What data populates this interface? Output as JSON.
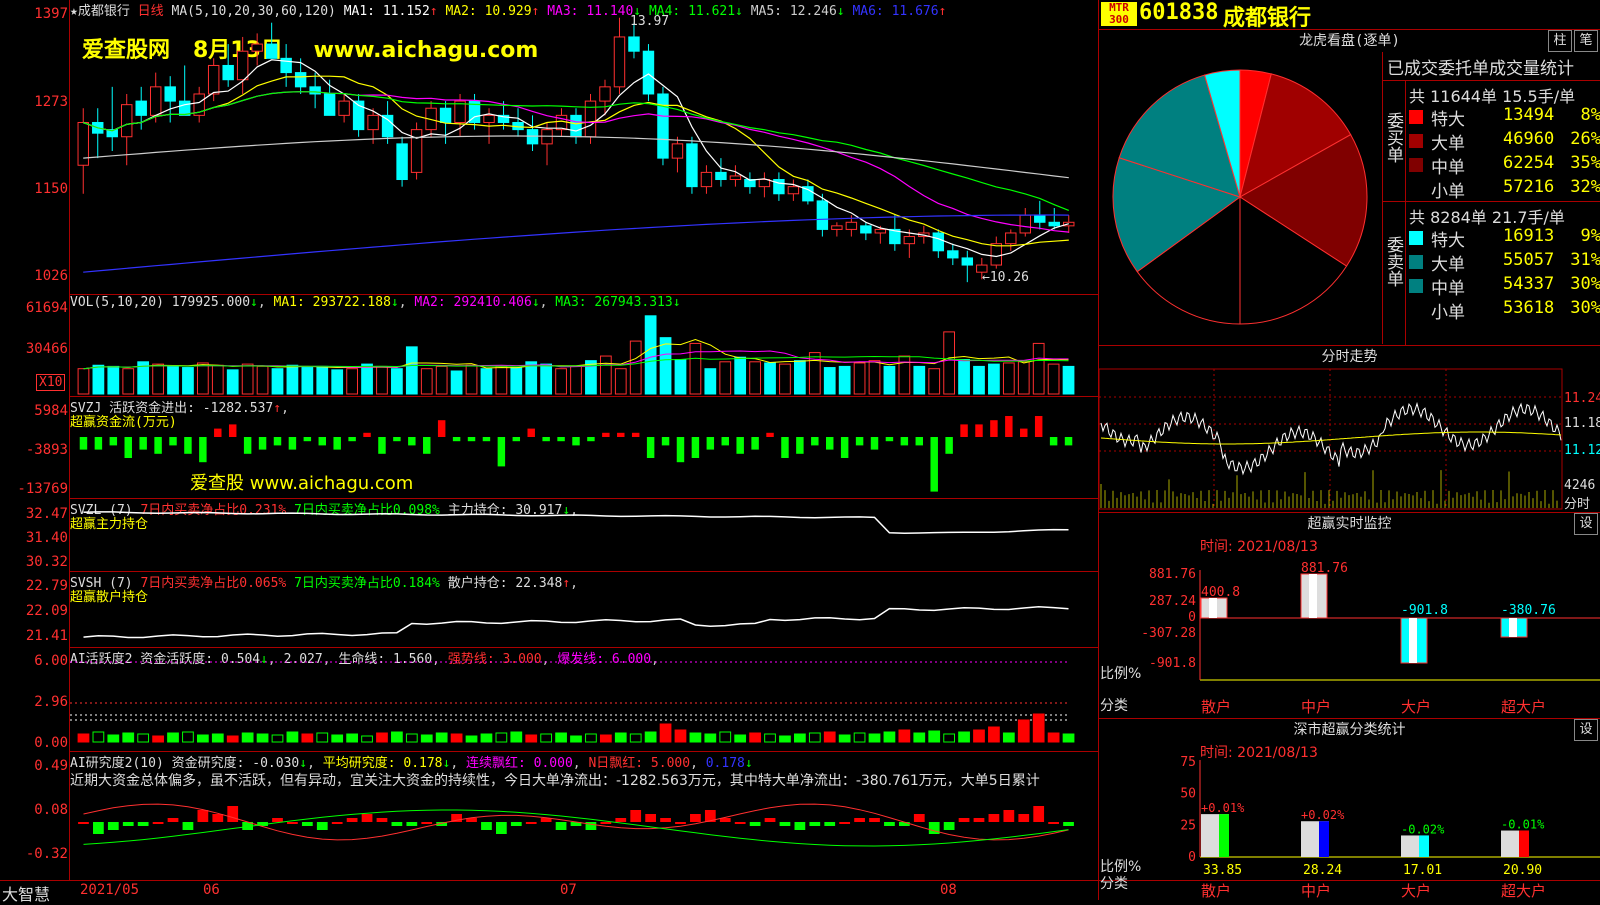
{
  "kline": {
    "header": {
      "name": "★成都银行",
      "period": "日线",
      "ma_def": "MA(5,10,20,30,60,120)",
      "ma1": "MA1: 11.152",
      "ma2": "MA2: 10.929",
      "ma3": "MA3: 11.140",
      "ma4": "MA4: 11.621",
      "ma5": "MA5: 12.246",
      "ma6": "MA6: 11.676"
    },
    "watermark": {
      "site": "爱查股网",
      "date": "8月13日",
      "url": "www.aichagu.com"
    },
    "axis": [
      "1397",
      "1273",
      "1150",
      "1026"
    ],
    "high_label": "13.97",
    "low_label": "←10.26",
    "candles": [
      {
        "o": 11.9,
        "h": 12.7,
        "l": 11.5,
        "c": 12.5
      },
      {
        "o": 12.5,
        "h": 12.7,
        "l": 12.0,
        "c": 12.35
      },
      {
        "o": 12.4,
        "h": 13.0,
        "l": 12.1,
        "c": 12.3
      },
      {
        "o": 12.3,
        "h": 12.9,
        "l": 11.9,
        "c": 12.75
      },
      {
        "o": 12.8,
        "h": 13.0,
        "l": 12.4,
        "c": 12.6
      },
      {
        "o": 12.6,
        "h": 13.2,
        "l": 12.5,
        "c": 13.0
      },
      {
        "o": 13.0,
        "h": 13.15,
        "l": 12.5,
        "c": 12.8
      },
      {
        "o": 12.8,
        "h": 13.3,
        "l": 12.6,
        "c": 12.6
      },
      {
        "o": 12.6,
        "h": 13.0,
        "l": 12.5,
        "c": 12.9
      },
      {
        "o": 12.9,
        "h": 13.4,
        "l": 12.8,
        "c": 13.3
      },
      {
        "o": 13.3,
        "h": 13.6,
        "l": 13.0,
        "c": 13.1
      },
      {
        "o": 13.1,
        "h": 13.7,
        "l": 12.9,
        "c": 13.5
      },
      {
        "o": 13.5,
        "h": 13.75,
        "l": 13.3,
        "c": 13.6
      },
      {
        "o": 13.6,
        "h": 13.9,
        "l": 13.4,
        "c": 13.4
      },
      {
        "o": 13.4,
        "h": 13.6,
        "l": 13.0,
        "c": 13.2
      },
      {
        "o": 13.2,
        "h": 13.4,
        "l": 12.9,
        "c": 13.0
      },
      {
        "o": 13.0,
        "h": 13.2,
        "l": 12.7,
        "c": 12.9
      },
      {
        "o": 12.9,
        "h": 13.1,
        "l": 12.6,
        "c": 12.6
      },
      {
        "o": 12.6,
        "h": 12.9,
        "l": 12.5,
        "c": 12.8
      },
      {
        "o": 12.8,
        "h": 12.9,
        "l": 12.3,
        "c": 12.4
      },
      {
        "o": 12.4,
        "h": 12.7,
        "l": 12.2,
        "c": 12.6
      },
      {
        "o": 12.6,
        "h": 12.8,
        "l": 12.2,
        "c": 12.3
      },
      {
        "o": 12.2,
        "h": 12.3,
        "l": 11.6,
        "c": 11.7
      },
      {
        "o": 11.8,
        "h": 12.5,
        "l": 11.7,
        "c": 12.4
      },
      {
        "o": 12.4,
        "h": 12.8,
        "l": 12.3,
        "c": 12.7
      },
      {
        "o": 12.7,
        "h": 12.8,
        "l": 12.2,
        "c": 12.5
      },
      {
        "o": 12.5,
        "h": 12.9,
        "l": 12.3,
        "c": 12.8
      },
      {
        "o": 12.8,
        "h": 12.9,
        "l": 12.4,
        "c": 12.5
      },
      {
        "o": 12.5,
        "h": 12.7,
        "l": 12.2,
        "c": 12.6
      },
      {
        "o": 12.6,
        "h": 12.8,
        "l": 12.4,
        "c": 12.5
      },
      {
        "o": 12.5,
        "h": 12.7,
        "l": 12.3,
        "c": 12.4
      },
      {
        "o": 12.4,
        "h": 12.6,
        "l": 12.1,
        "c": 12.2
      },
      {
        "o": 12.2,
        "h": 12.5,
        "l": 11.9,
        "c": 12.4
      },
      {
        "o": 12.4,
        "h": 12.7,
        "l": 12.3,
        "c": 12.6
      },
      {
        "o": 12.6,
        "h": 12.7,
        "l": 12.2,
        "c": 12.3
      },
      {
        "o": 12.3,
        "h": 12.9,
        "l": 12.2,
        "c": 12.8
      },
      {
        "o": 12.8,
        "h": 13.1,
        "l": 12.6,
        "c": 13.0
      },
      {
        "o": 13.0,
        "h": 13.97,
        "l": 12.9,
        "c": 13.7
      },
      {
        "o": 13.7,
        "h": 13.9,
        "l": 13.4,
        "c": 13.5
      },
      {
        "o": 13.5,
        "h": 13.6,
        "l": 12.8,
        "c": 12.9
      },
      {
        "o": 12.9,
        "h": 13.0,
        "l": 11.9,
        "c": 12.0
      },
      {
        "o": 12.0,
        "h": 12.3,
        "l": 11.8,
        "c": 12.2
      },
      {
        "o": 12.2,
        "h": 12.3,
        "l": 11.5,
        "c": 11.6
      },
      {
        "o": 11.6,
        "h": 11.9,
        "l": 11.5,
        "c": 11.8
      },
      {
        "o": 11.8,
        "h": 12.0,
        "l": 11.6,
        "c": 11.7
      },
      {
        "o": 11.7,
        "h": 11.9,
        "l": 11.6,
        "c": 11.75
      },
      {
        "o": 11.7,
        "h": 11.8,
        "l": 11.5,
        "c": 11.6
      },
      {
        "o": 11.6,
        "h": 11.8,
        "l": 11.45,
        "c": 11.7
      },
      {
        "o": 11.7,
        "h": 11.8,
        "l": 11.4,
        "c": 11.5
      },
      {
        "o": 11.5,
        "h": 11.7,
        "l": 11.4,
        "c": 11.6
      },
      {
        "o": 11.6,
        "h": 11.7,
        "l": 11.35,
        "c": 11.4
      },
      {
        "o": 11.4,
        "h": 11.5,
        "l": 10.9,
        "c": 11.0
      },
      {
        "o": 11.0,
        "h": 11.1,
        "l": 10.9,
        "c": 11.05
      },
      {
        "o": 11.0,
        "h": 11.2,
        "l": 10.9,
        "c": 11.1
      },
      {
        "o": 11.05,
        "h": 11.1,
        "l": 10.85,
        "c": 10.95
      },
      {
        "o": 10.95,
        "h": 11.05,
        "l": 10.8,
        "c": 11.0
      },
      {
        "o": 11.0,
        "h": 11.2,
        "l": 10.7,
        "c": 10.8
      },
      {
        "o": 10.8,
        "h": 11.0,
        "l": 10.6,
        "c": 10.9
      },
      {
        "o": 10.9,
        "h": 11.05,
        "l": 10.8,
        "c": 10.95
      },
      {
        "o": 10.95,
        "h": 11.0,
        "l": 10.6,
        "c": 10.7
      },
      {
        "o": 10.7,
        "h": 10.8,
        "l": 10.5,
        "c": 10.6
      },
      {
        "o": 10.6,
        "h": 10.7,
        "l": 10.26,
        "c": 10.5
      },
      {
        "o": 10.4,
        "h": 10.6,
        "l": 10.3,
        "c": 10.5
      },
      {
        "o": 10.5,
        "h": 10.9,
        "l": 10.45,
        "c": 10.8
      },
      {
        "o": 10.8,
        "h": 11.0,
        "l": 10.7,
        "c": 10.95
      },
      {
        "o": 10.95,
        "h": 11.3,
        "l": 10.9,
        "c": 11.2
      },
      {
        "o": 11.2,
        "h": 11.4,
        "l": 11.0,
        "c": 11.1
      },
      {
        "o": 11.1,
        "h": 11.3,
        "l": 11.0,
        "c": 11.05
      },
      {
        "o": 11.05,
        "h": 11.2,
        "l": 10.95,
        "c": 11.1
      }
    ]
  },
  "vol": {
    "header": "VOL(5,10,20)",
    "vol": "179925.000",
    "ma1": "MA1: 293722.188",
    "ma2": "MA2: 292410.406",
    "ma3": "MA3: 267943.313",
    "axis": [
      "61694",
      "30466"
    ],
    "unit": "X10",
    "bars": [
      22,
      25,
      24,
      22,
      28,
      26,
      24,
      23,
      27,
      25,
      21,
      26,
      24,
      22,
      25,
      23,
      24,
      21,
      22,
      26,
      24,
      22,
      41,
      22,
      24,
      20,
      25,
      22,
      24,
      23,
      28,
      26,
      22,
      24,
      29,
      33,
      22,
      46,
      68,
      49,
      30,
      44,
      22,
      28,
      32,
      28,
      27,
      26,
      29,
      36,
      23,
      24,
      27,
      29,
      24,
      33,
      24,
      22,
      54,
      30,
      24,
      26,
      27,
      28,
      44,
      26,
      24
    ]
  },
  "svzj": {
    "header": "SVZJ 活跃资金进出: -1282.537",
    "sub": "超赢资金流(万元)",
    "axis": [
      "5984",
      "-3893",
      "-13769"
    ],
    "watermark": "爱查股 www.aichagu.com",
    "values": [
      -3,
      -3,
      -2,
      -5,
      -3,
      -4,
      -2,
      -4,
      -6,
      2,
      3,
      -4,
      -3,
      -2,
      -3,
      -1,
      -2,
      -3,
      -1,
      1,
      -4,
      -1,
      -2,
      -4,
      4,
      -1,
      -1,
      -1,
      -7,
      -1,
      2,
      -1,
      -1,
      -2,
      -1,
      1,
      1,
      1,
      -5,
      -2,
      -6,
      -5,
      -3,
      -2,
      -4,
      -3,
      1,
      -5,
      -4,
      -2,
      -3,
      -5,
      -2,
      -3,
      -1,
      -2,
      -2,
      -13,
      -4,
      3,
      3,
      4,
      5,
      2,
      5,
      -2,
      -2
    ]
  },
  "svzl": {
    "header_a": "SVZL (7)",
    "stat1": "7日内买卖净占比0.231%",
    "stat2": "7日内买卖净占比0.098%",
    "val": "主力持仓: 30.917",
    "sub": "超赢主力持仓",
    "axis": [
      "32.47",
      "31.40",
      "30.32"
    ]
  },
  "svsh": {
    "header_a": "SVSH (7)",
    "stat1": "7日内买卖净占比0.065%",
    "stat2": "7日内买卖净占比0.184%",
    "val": "散户持仓: 22.348",
    "sub": "超赢散户持仓",
    "axis": [
      "22.79",
      "22.09",
      "21.41"
    ]
  },
  "ai1": {
    "header": "AI活跃度2 资金活跃度: 0.504",
    "v2": "2.027",
    "life": "生命线: 1.560",
    "strong": "强势线: 3.000",
    "burst": "爆发线: 6.000",
    "axis": [
      "6.00",
      "2.96",
      "0.00"
    ]
  },
  "ai2": {
    "header": "AI研究度2(10) 资金研究度: -0.030",
    "avg": "平均研究度: 0.178",
    "cont": "连续飘红: 0.000",
    "nday": "N日飘红: 5.000",
    "last": "0.178",
    "comment": "近期大资金总体偏多，虽不活跃，但有异动，宜关注大资金的持续性，今日大单净流出：-1282.563万元，其中特大单净流出：-380.761万元，大单5日累计",
    "axis": [
      "0.49",
      "0.08",
      "-0.32"
    ]
  },
  "dates": {
    "app": "大智慧",
    "d1": "2021/05",
    "d2": "06",
    "d3": "07",
    "d4": "08"
  },
  "right": {
    "code": "601838",
    "name": "成都银行",
    "badge1": "MTR",
    "badge2": "300",
    "tab1": "柱",
    "tab2": "笔",
    "lhb_title": "龙虎看盘(逐单)",
    "stat_title": "已成交委托单成交量统计",
    "buy_total": "共 11644单 15.5手/单",
    "buy_label": "委买单",
    "buy": [
      {
        "k": "特大",
        "v": "13494",
        "p": "8%",
        "c": "#ff0000"
      },
      {
        "k": "大单",
        "v": "46960",
        "p": "26%",
        "c": "#a00000"
      },
      {
        "k": "中单",
        "v": "62254",
        "p": "35%",
        "c": "#800000"
      },
      {
        "k": "小单",
        "v": "57216",
        "p": "32%",
        "c": "#000000"
      }
    ],
    "sell_total": "共 8284单 21.7手/单",
    "sell_label": "委卖单",
    "sell": [
      {
        "k": "特大",
        "v": "16913",
        "p": "9%",
        "c": "#00ffff"
      },
      {
        "k": "大单",
        "v": "55057",
        "p": "31%",
        "c": "#008080"
      },
      {
        "k": "中单",
        "v": "54337",
        "p": "30%",
        "c": "#008080"
      },
      {
        "k": "小单",
        "v": "53618",
        "p": "30%",
        "c": "#000000"
      }
    ],
    "fs_title": "分时走势",
    "fs_axis": [
      "11.24",
      "11.18",
      "11.12"
    ],
    "fs_vol": "4246",
    "fs_unit": "分时",
    "mon_title": "超赢实时监控",
    "mon_time": "时间: 2021/08/13",
    "set": "设",
    "mon_axis": [
      "881.76",
      "287.24",
      "0",
      "-307.28",
      "-901.8"
    ],
    "mon_bars": [
      {
        "k": "散户",
        "v": 400.8,
        "lab": "400.8"
      },
      {
        "k": "中户",
        "v": 881.76,
        "lab": "881.76"
      },
      {
        "k": "大户",
        "v": -901.8,
        "lab": "-901.8"
      },
      {
        "k": "超大户",
        "v": -380.76,
        "lab": "-380.76"
      }
    ],
    "ratio": "比例%",
    "cat": "分类",
    "sz_title": "深市超赢分类统计",
    "sz_time": "时间: 2021/08/13",
    "sz_axis": [
      "75",
      "50",
      "25",
      "0"
    ],
    "sz_bars": [
      {
        "k": "散户",
        "v": 33.85,
        "chg": "+0.01%",
        "col": "#00ff00"
      },
      {
        "k": "中户",
        "v": 28.24,
        "chg": "+0.02%",
        "col": "#0000ff"
      },
      {
        "k": "大户",
        "v": 17.01,
        "chg": "-0.02%",
        "col": "#00ffff"
      },
      {
        "k": "超大户",
        "v": 20.9,
        "chg": "-0.01%",
        "col": "#ff0000"
      }
    ],
    "sz_vals": [
      "33.85",
      "28.24",
      "17.01",
      "20.90"
    ]
  }
}
